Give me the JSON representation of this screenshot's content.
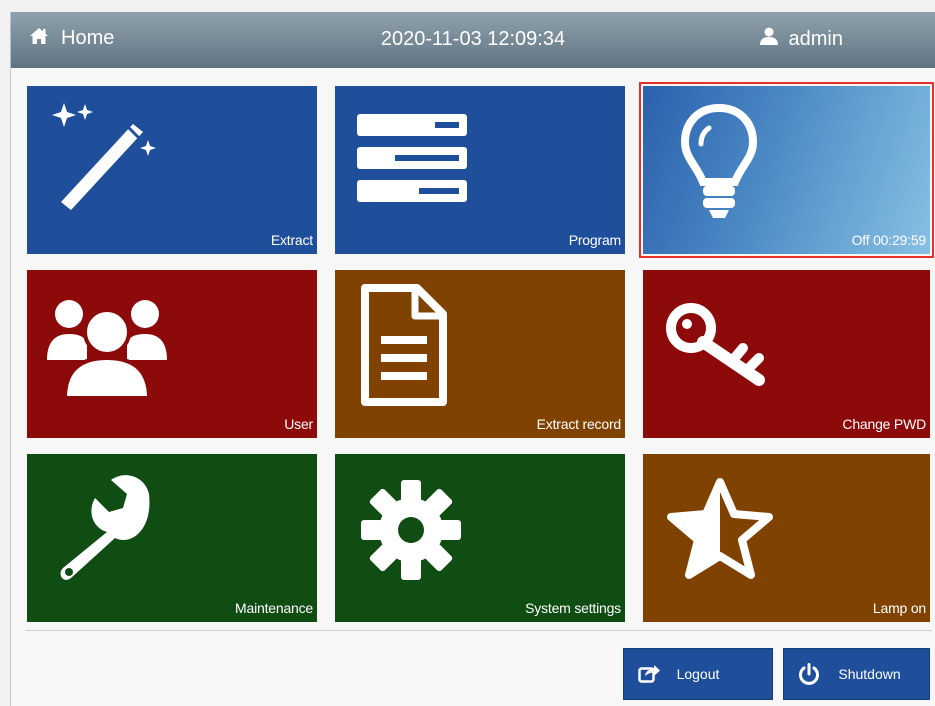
{
  "header": {
    "home_label": "Home",
    "datetime": "2020-11-03 12:09:34",
    "username": "admin"
  },
  "tiles": [
    {
      "label": "Extract",
      "icon": "magic-wand-icon",
      "color": "#1f4f9a"
    },
    {
      "label": "Program",
      "icon": "program-list-icon",
      "color": "#1f4f9a"
    },
    {
      "label": "Off 00:29:59",
      "icon": "light-bulb-icon",
      "color": "#4d8bc6"
    },
    {
      "label": "User",
      "icon": "users-icon",
      "color": "#8c0a0a"
    },
    {
      "label": "Extract record",
      "icon": "document-icon",
      "color": "#7f4200"
    },
    {
      "label": "Change PWD",
      "icon": "key-icon",
      "color": "#8c0a0a"
    },
    {
      "label": "Maintenance",
      "icon": "wrench-icon",
      "color": "#0f4d12"
    },
    {
      "label": "System settings",
      "icon": "gear-icon",
      "color": "#0f4d12"
    },
    {
      "label": "Lamp on",
      "icon": "half-star-icon",
      "color": "#7f4200"
    }
  ],
  "footer": {
    "logout_label": "Logout",
    "shutdown_label": "Shutdown"
  },
  "colors": {
    "selected_outline": "#e8302b",
    "header": "#6f8390"
  }
}
